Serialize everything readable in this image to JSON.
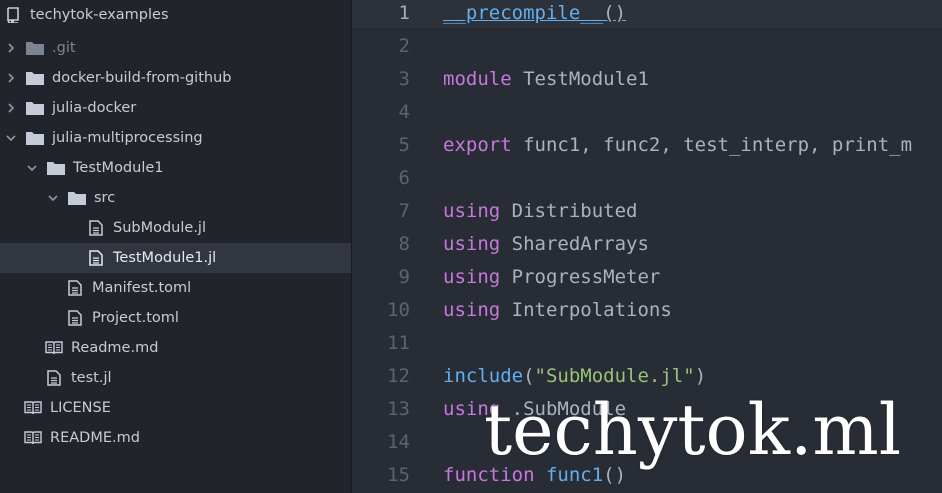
{
  "sidebar": {
    "project_name": "techytok-examples",
    "items": [
      {
        "label": ".git"
      },
      {
        "label": "docker-build-from-github"
      },
      {
        "label": "julia-docker"
      },
      {
        "label": "julia-multiprocessing"
      },
      {
        "label": "TestModule1"
      },
      {
        "label": "src"
      },
      {
        "label": "SubModule.jl"
      },
      {
        "label": "TestModule1.jl"
      },
      {
        "label": "Manifest.toml"
      },
      {
        "label": "Project.toml"
      },
      {
        "label": "Readme.md"
      },
      {
        "label": "test.jl"
      },
      {
        "label": "LICENSE"
      },
      {
        "label": "README.md"
      }
    ]
  },
  "editor": {
    "line_numbers": [
      "1",
      "2",
      "3",
      "4",
      "5",
      "6",
      "7",
      "8",
      "9",
      "10",
      "11",
      "12",
      "13",
      "14",
      "15"
    ],
    "lines": {
      "l1": {
        "a": "__precompile__",
        "b": "()"
      },
      "l3": {
        "kw": "module",
        "rest": " TestModule1"
      },
      "l5": {
        "kw": "export",
        "rest": " func1, func2, test_interp, print_m"
      },
      "l7": {
        "kw": "using",
        "rest": " Distributed"
      },
      "l8": {
        "kw": "using",
        "rest": " SharedArrays"
      },
      "l9": {
        "kw": "using",
        "rest": " ProgressMeter"
      },
      "l10": {
        "kw": "using",
        "rest": " Interpolations"
      },
      "l12": {
        "fn": "include",
        "p1": "(",
        "str": "\"SubModule.jl\"",
        "p2": ")"
      },
      "l13": {
        "kw": "using",
        "rest": " .SubModule"
      },
      "l15": {
        "kw": "function",
        "fn": " func1",
        "rest": "()"
      }
    }
  },
  "watermark": "techytok.ml",
  "colors": {
    "sidebar_bg": "#21252b",
    "editor_bg": "#282c34",
    "keyword": "#c678dd",
    "function": "#61afef",
    "string": "#98c379",
    "text": "#abb2bf",
    "line_number": "#5c6370"
  }
}
